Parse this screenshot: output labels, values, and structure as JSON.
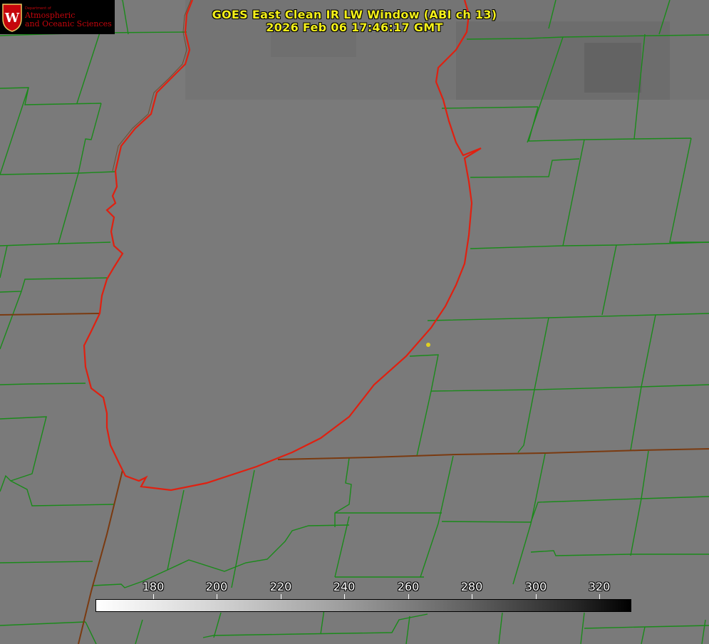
{
  "title": {
    "line1": "GOES East Clean IR LW Window (ABI ch 13)",
    "line2": "2026 Feb 06 17:46:17 GMT"
  },
  "logo": {
    "dept": "Department of",
    "line1": "Atmospheric",
    "line2": "and Oceanic Sciences",
    "crest_letter": "W"
  },
  "colorbar": {
    "ticks": [
      "180",
      "200",
      "220",
      "240",
      "260",
      "280",
      "300",
      "320"
    ],
    "gradient_colors": [
      "#ffffff",
      "#000000"
    ]
  },
  "colors": {
    "county_lines": "#1a8a1a",
    "lake_outline": "#e02010",
    "state_line": "#7a3a10",
    "station_dot": "#e0d020",
    "title_text": "#f4f01a"
  },
  "icons": {
    "station_marker": "dot"
  }
}
